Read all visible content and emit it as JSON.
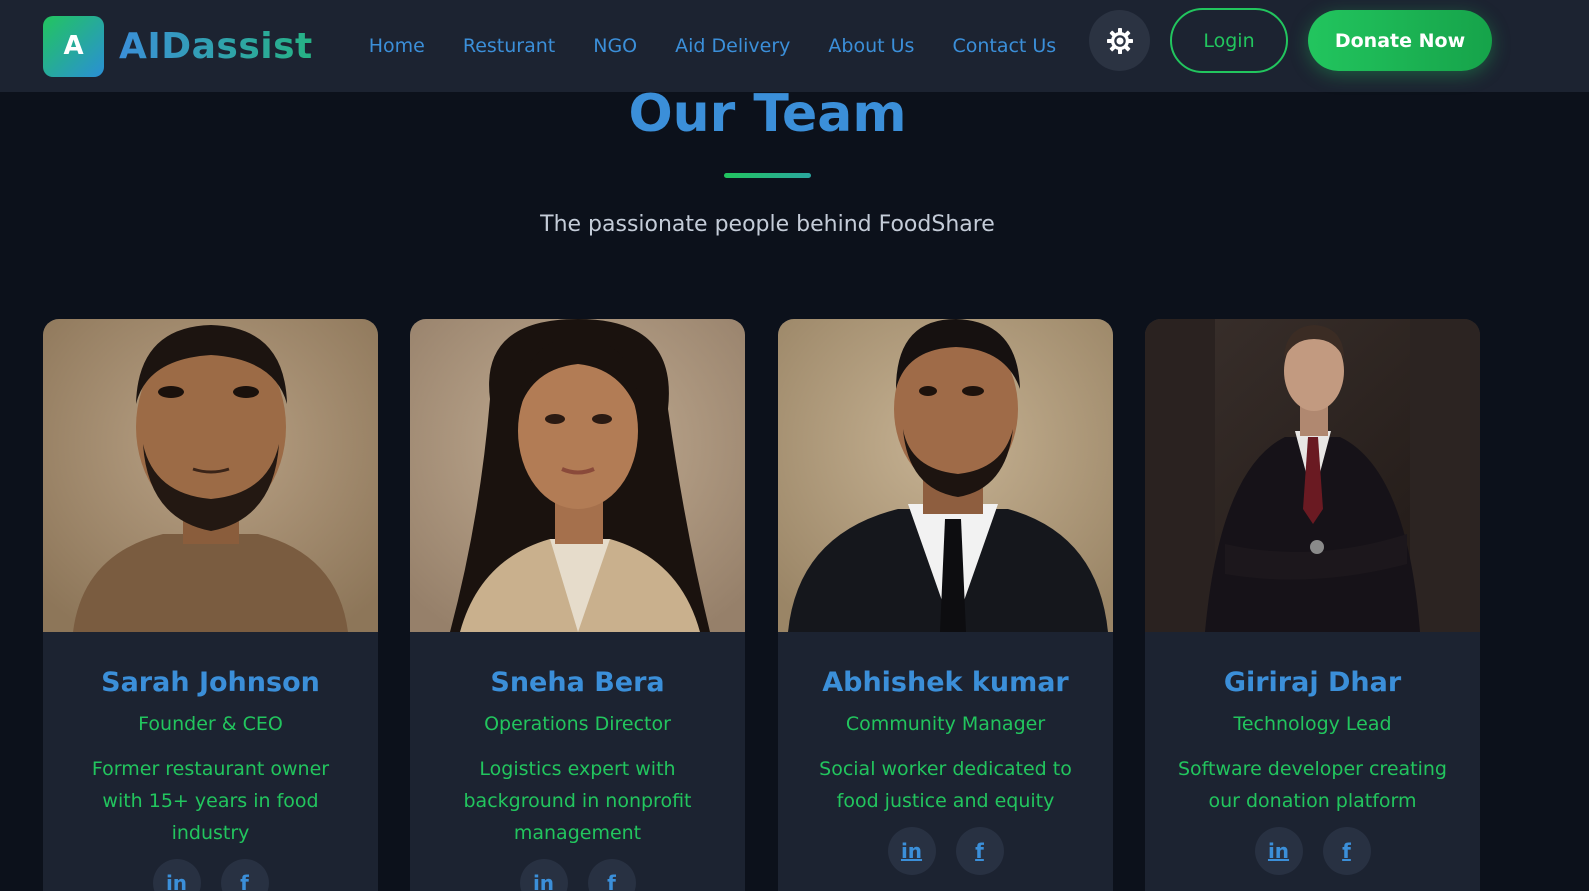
{
  "header": {
    "logo_letter": "A",
    "brand": "AIDassist",
    "nav": [
      {
        "label": "Home"
      },
      {
        "label": "Resturant"
      },
      {
        "label": "NGO"
      },
      {
        "label": "Aid Delivery"
      },
      {
        "label": "About Us"
      },
      {
        "label": "Contact Us"
      }
    ],
    "theme_icon": "gear-icon",
    "login_label": "Login",
    "donate_label": "Donate Now"
  },
  "section": {
    "title": "Our Team",
    "subtitle": "The passionate people behind FoodShare"
  },
  "team": [
    {
      "name": "Sarah Johnson",
      "role": "Founder & CEO",
      "bio": "Former restaurant owner with 15+ years in food industry",
      "photo": "portrait of bearded man in brown sweater"
    },
    {
      "name": "Sneha Bera",
      "role": "Operations Director",
      "bio": "Logistics expert with background in nonprofit management",
      "photo": "portrait of woman in beige blazer"
    },
    {
      "name": "Abhishek kumar",
      "role": "Community Manager",
      "bio": "Social worker dedicated to food justice and equity",
      "photo": "portrait of bearded man in black suit and tie"
    },
    {
      "name": "Giriraj Dhar",
      "role": "Technology Lead",
      "bio": "Software developer creating our donation platform",
      "photo": "portrait of man in dark suit with crossed arms"
    }
  ],
  "social_icons": {
    "linkedin": "in",
    "facebook": "f"
  },
  "colors": {
    "background": "#0c111b",
    "nav_background": "#1c2331",
    "card_background": "#1c2331",
    "accent_blue": "#3b8fd9",
    "accent_green": "#22c55e"
  }
}
